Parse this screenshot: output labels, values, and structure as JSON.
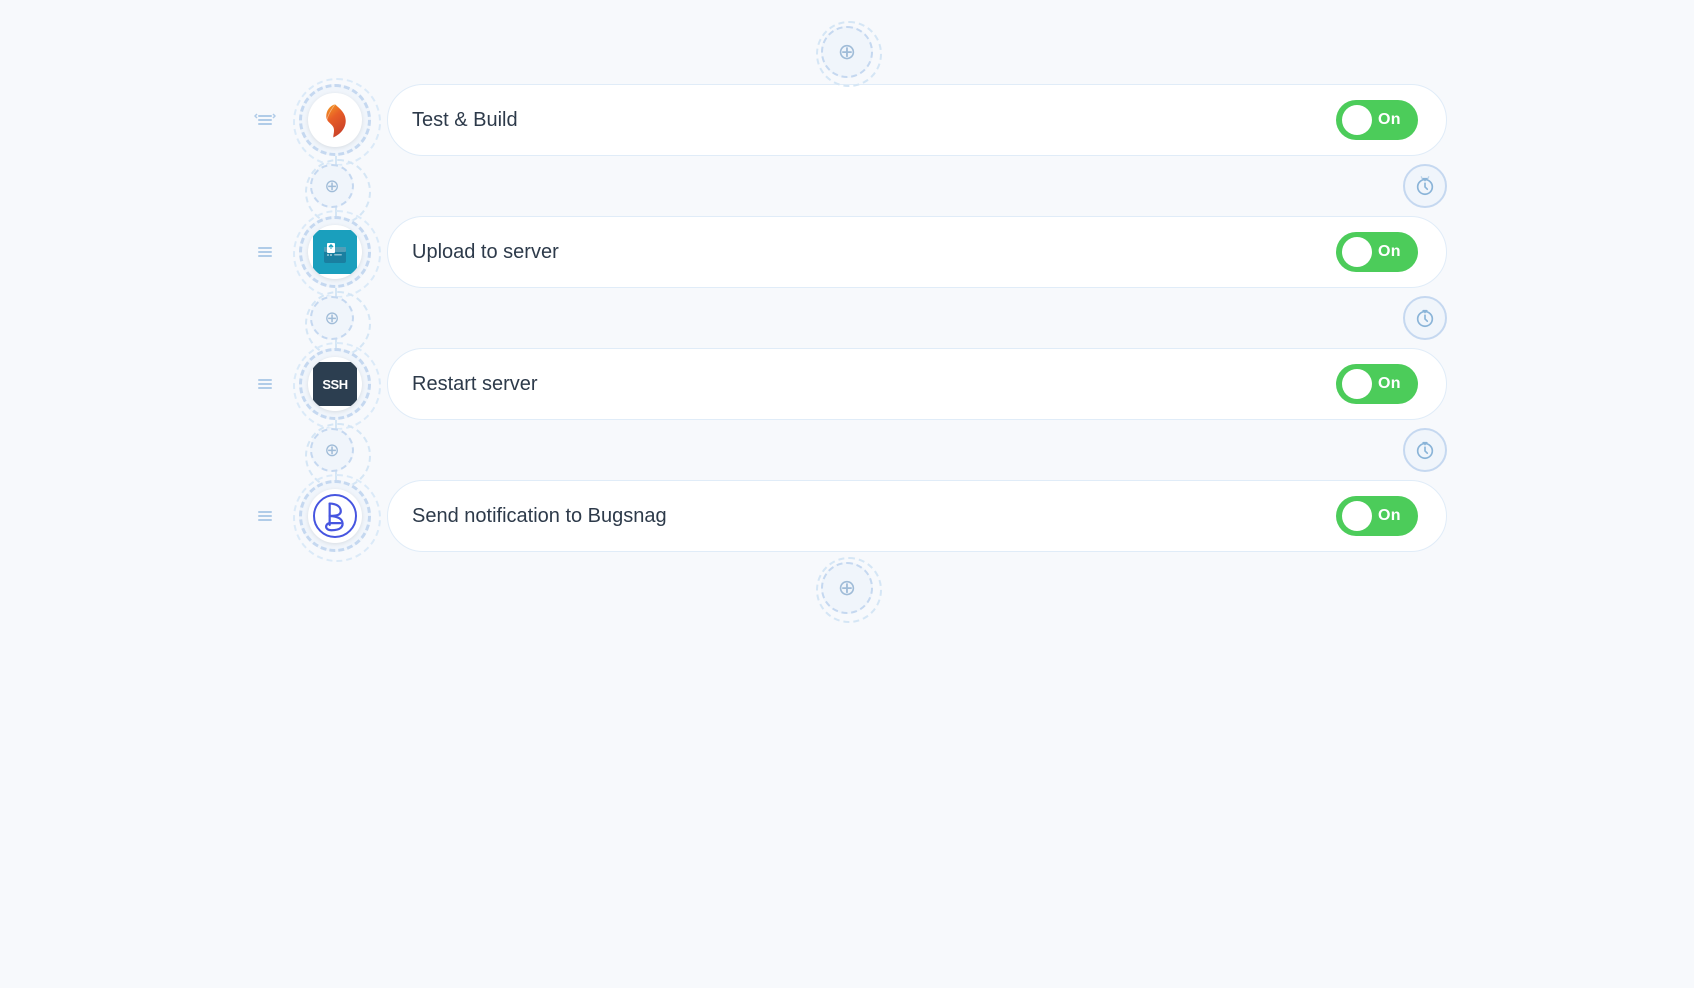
{
  "pipeline": {
    "steps": [
      {
        "id": "test-build",
        "label": "Test & Build",
        "icon_type": "maven",
        "toggle_state": "On",
        "toggle_on": true
      },
      {
        "id": "upload-server",
        "label": "Upload to server",
        "icon_type": "upload",
        "toggle_state": "On",
        "toggle_on": true
      },
      {
        "id": "restart-server",
        "label": "Restart server",
        "icon_type": "ssh",
        "toggle_state": "On",
        "toggle_on": true
      },
      {
        "id": "send-bugsnag",
        "label": "Send notification to Bugsnag",
        "icon_type": "bugsnag",
        "toggle_state": "On",
        "toggle_on": true
      }
    ],
    "add_button_label": "+",
    "timer_icon": "⏳",
    "toggle_on_label": "On"
  }
}
